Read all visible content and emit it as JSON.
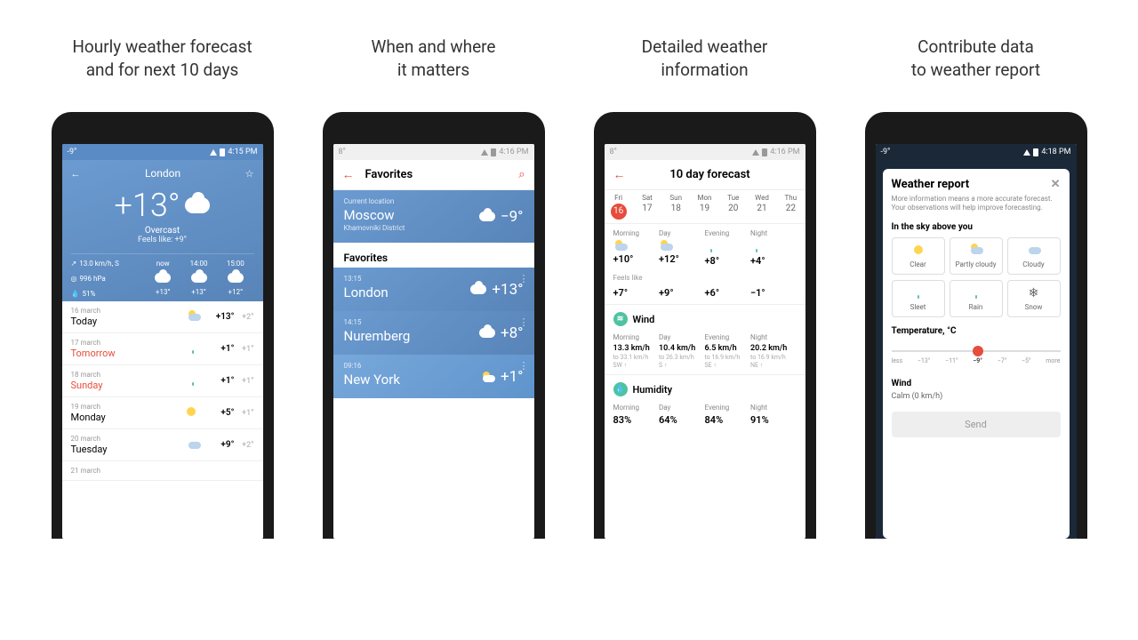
{
  "captions": {
    "s1a": "Hourly weather forecast",
    "s1b": "and for next 10 days",
    "s2a": "When and where",
    "s2b": "it matters",
    "s3a": "Detailed weather",
    "s3b": "information",
    "s4a": "Contribute data",
    "s4b": "to weather report"
  },
  "status": {
    "t1": "-9°",
    "time1": "4:15 PM",
    "t2": "8°",
    "time2": "4:16 PM",
    "t3": "8°",
    "time3": "4:16 PM",
    "t4": "-9°",
    "time4": "4:18 PM"
  },
  "s1": {
    "city": "London",
    "temp": "+13°",
    "cond": "Overcast",
    "feels": "Feels like: +9°",
    "wind": "13.0 km/h, S",
    "press": "996 hPa",
    "precip": "51%",
    "hours": {
      "h0": "now",
      "h1": "14:00",
      "h2": "15:00",
      "t0": "+13°",
      "t1": "+13°",
      "t2": "+12°"
    },
    "days": [
      {
        "date": "16 march",
        "name": "Today",
        "hi": "+13°",
        "lo": "+2°",
        "red": false
      },
      {
        "date": "17 march",
        "name": "Tomorrow",
        "hi": "+1°",
        "lo": "+1°",
        "red": true
      },
      {
        "date": "18 march",
        "name": "Sunday",
        "hi": "+1°",
        "lo": "+1°",
        "red": true
      },
      {
        "date": "19 march",
        "name": "Monday",
        "hi": "+5°",
        "lo": "+1°",
        "red": false
      },
      {
        "date": "20 march",
        "name": "Tuesday",
        "hi": "+9°",
        "lo": "+2°",
        "red": false
      },
      {
        "date": "21 march",
        "name": "",
        "hi": "",
        "lo": "",
        "red": false
      }
    ]
  },
  "s2": {
    "title": "Favorites",
    "cur_label": "Current location",
    "cur_city": "Moscow",
    "cur_dist": "Khamovniki District",
    "cur_temp": "−9°",
    "fav_header": "Favorites",
    "items": [
      {
        "time": "13:15",
        "city": "London",
        "temp": "+13°"
      },
      {
        "time": "14:15",
        "city": "Nuremberg",
        "temp": "+8°"
      },
      {
        "time": "09:16",
        "city": "New York",
        "temp": "+1°"
      }
    ]
  },
  "s3": {
    "title": "10 day forecast",
    "tabs": [
      {
        "d": "Fri",
        "n": "16",
        "active": true
      },
      {
        "d": "Sat",
        "n": "17"
      },
      {
        "d": "Sun",
        "n": "18"
      },
      {
        "d": "Mon",
        "n": "19"
      },
      {
        "d": "Tue",
        "n": "20"
      },
      {
        "d": "Wed",
        "n": "21"
      },
      {
        "d": "Thu",
        "n": "22"
      }
    ],
    "parts": {
      "p0": "Morning",
      "p1": "Day",
      "p2": "Evening",
      "p3": "Night"
    },
    "temp": {
      "v0": "+10°",
      "v1": "+12°",
      "v2": "+8°",
      "v3": "+4°"
    },
    "feels_label": "Feels like",
    "feels": {
      "v0": "+7°",
      "v1": "+9°",
      "v2": "+6°",
      "v3": "−1°"
    },
    "wind_label": "Wind",
    "wind": {
      "v0": "13.3 km/h",
      "s0": "to 33.1 km/h",
      "d0": "SW ↑",
      "v1": "10.4 km/h",
      "s1": "to 26.3 km/h",
      "d1": "S ↑",
      "v2": "6.5 km/h",
      "s2": "to 16.9 km/h",
      "d2": "SE ↑",
      "v3": "20.2 km/h",
      "s3": "to 16.9 km/h",
      "d3": "NE ↑"
    },
    "hum_label": "Humidity",
    "hum": {
      "v0": "83%",
      "v1": "64%",
      "v2": "84%",
      "v3": "91%"
    }
  },
  "s4": {
    "title": "Weather report",
    "desc": "More information means a more accurate forecast. Your observations will help improve forecasting.",
    "sky_label": "In the sky above you",
    "tiles": [
      {
        "l": "Clear"
      },
      {
        "l": "Partly cloudy"
      },
      {
        "l": "Cloudy"
      },
      {
        "l": "Sleet"
      },
      {
        "l": "Rain"
      },
      {
        "l": "Snow"
      }
    ],
    "temp_label": "Temperature, °C",
    "ticks": {
      "t0": "less",
      "t1": "−13°",
      "t2": "−11°",
      "t3": "−9°",
      "t4": "−7°",
      "t5": "−5°",
      "t6": "more"
    },
    "wind_label": "Wind",
    "calm": "Calm (0 km/h)",
    "send": "Send"
  }
}
